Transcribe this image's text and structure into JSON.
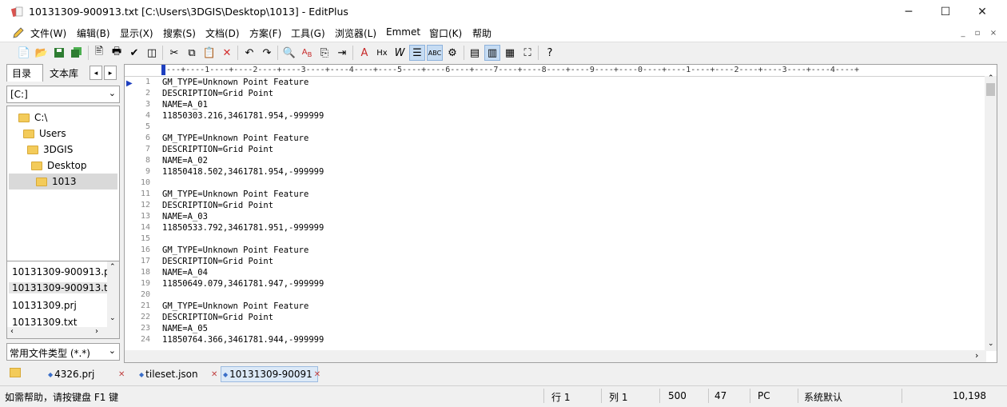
{
  "window": {
    "title": "10131309-900913.txt [C:\\Users\\3DGIS\\Desktop\\1013] - EditPlus",
    "minimize": "─",
    "maximize": "☐",
    "close": "✕"
  },
  "menu": {
    "items": [
      "文件(W)",
      "编辑(B)",
      "显示(X)",
      "搜索(S)",
      "文档(D)",
      "方案(F)",
      "工具(G)",
      "浏览器(L)",
      "Emmet",
      "窗口(K)",
      "帮助"
    ]
  },
  "sidebar": {
    "tab_directory": "目录",
    "tab_library": "文本库",
    "drive": "[C:]",
    "tree": [
      "C:\\",
      "Users",
      "3DGIS",
      "Desktop",
      "1013"
    ],
    "files": [
      "10131309-900913.p",
      "10131309-900913.tx",
      "10131309.prj",
      "10131309.txt"
    ],
    "filetype": "常用文件类型 (*.*)"
  },
  "editor": {
    "ruler": "----+----1----+----2----+----3----+----4----+----5----+----6----+----7----+----8----+----9----+----0----+----1----+----2----+----3----+----4----+",
    "lines": [
      "GM_TYPE=Unknown Point Feature",
      "DESCRIPTION=Grid Point",
      "NAME=A_01",
      "11850303.216,3461781.954,-999999",
      "",
      "GM_TYPE=Unknown Point Feature",
      "DESCRIPTION=Grid Point",
      "NAME=A_02",
      "11850418.502,3461781.954,-999999",
      "",
      "GM_TYPE=Unknown Point Feature",
      "DESCRIPTION=Grid Point",
      "NAME=A_03",
      "11850533.792,3461781.951,-999999",
      "",
      "GM_TYPE=Unknown Point Feature",
      "DESCRIPTION=Grid Point",
      "NAME=A_04",
      "11850649.079,3461781.947,-999999",
      "",
      "GM_TYPE=Unknown Point Feature",
      "DESCRIPTION=Grid Point",
      "NAME=A_05",
      "11850764.366,3461781.944,-999999"
    ]
  },
  "doc_tabs": [
    {
      "label": "4326.prj",
      "active": false
    },
    {
      "label": "tileset.json",
      "active": false
    },
    {
      "label": "10131309-90091",
      "active": true
    }
  ],
  "status": {
    "help": "如需帮助，请按键盘 F1 键",
    "line": "行 1",
    "col": "列 1",
    "total": "500",
    "chars": "47",
    "mode": "PC",
    "encoding": "系统默认",
    "size": "10,198"
  },
  "icons": {
    "app": "editplus-icon",
    "colors": {
      "accent": "#c6dcf3",
      "folder": "#f3cb5a"
    }
  }
}
